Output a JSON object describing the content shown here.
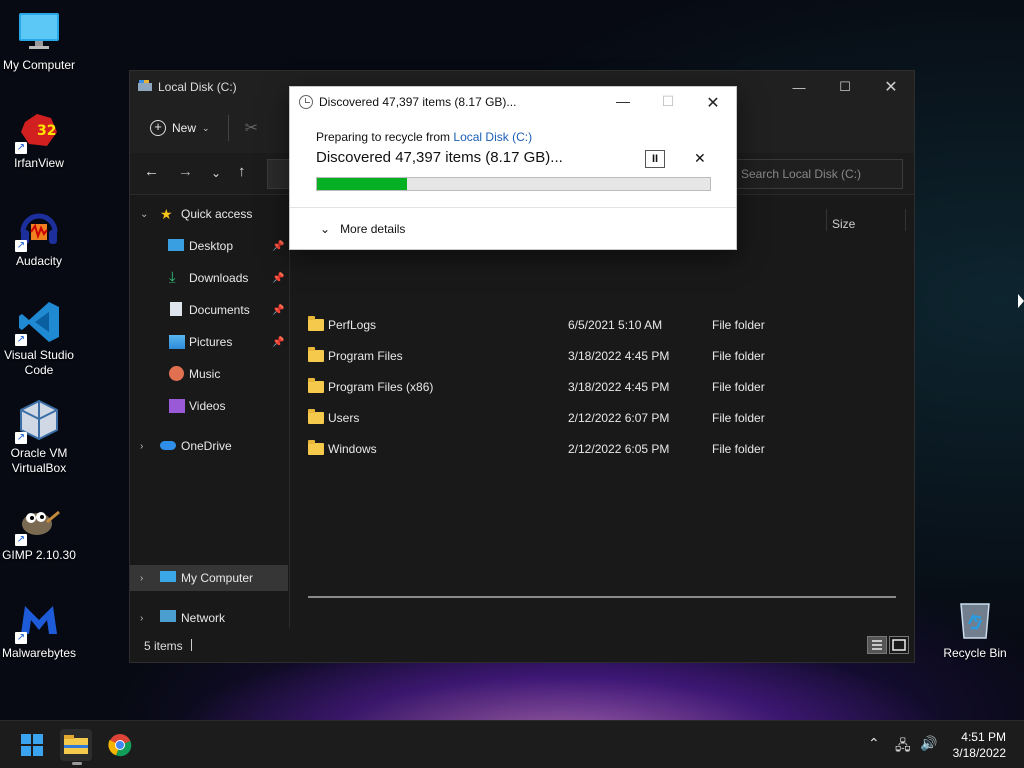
{
  "desktop": {
    "icons": [
      {
        "label": "My Computer"
      },
      {
        "label": "IrfanView",
        "badge": "32"
      },
      {
        "label": "Audacity"
      },
      {
        "label": "Visual Studio Code"
      },
      {
        "label": "Oracle VM VirtualBox"
      },
      {
        "label": "GIMP 2.10.30"
      },
      {
        "label": "Malwarebytes"
      }
    ],
    "recycle_bin": "Recycle Bin"
  },
  "explorer": {
    "title": "Local Disk (C:)",
    "toolbar": {
      "new_label": "New"
    },
    "search_placeholder": "Search Local Disk (C:)",
    "sidebar": {
      "quick_access": "Quick access",
      "items": [
        {
          "label": "Desktop"
        },
        {
          "label": "Downloads"
        },
        {
          "label": "Documents"
        },
        {
          "label": "Pictures"
        },
        {
          "label": "Music"
        },
        {
          "label": "Videos"
        }
      ],
      "onedrive": "OneDrive",
      "my_computer": "My Computer",
      "network": "Network"
    },
    "columns": {
      "size": "Size"
    },
    "rows": [
      {
        "name": "PerfLogs",
        "date": "6/5/2021 5:10 AM",
        "type": "File folder"
      },
      {
        "name": "Program Files",
        "date": "3/18/2022 4:45 PM",
        "type": "File folder"
      },
      {
        "name": "Program Files (x86)",
        "date": "3/18/2022 4:45 PM",
        "type": "File folder"
      },
      {
        "name": "Users",
        "date": "2/12/2022 6:07 PM",
        "type": "File folder"
      },
      {
        "name": "Windows",
        "date": "2/12/2022 6:05 PM",
        "type": "File folder"
      }
    ],
    "status": {
      "count": "5 items"
    }
  },
  "dialog": {
    "title": "Discovered 47,397 items (8.17 GB)...",
    "preparing_prefix": "Preparing to recycle from ",
    "preparing_link": "Local Disk (C:)",
    "headline": "Discovered 47,397 items (8.17 GB)...",
    "progress_fraction": 0.23,
    "more_details": "More details"
  },
  "taskbar": {
    "time": "4:51 PM",
    "date": "3/18/2022"
  },
  "colors": {
    "progress_fill": "#06b025",
    "link": "#1a5fb4",
    "folder": "#f5c94c"
  }
}
